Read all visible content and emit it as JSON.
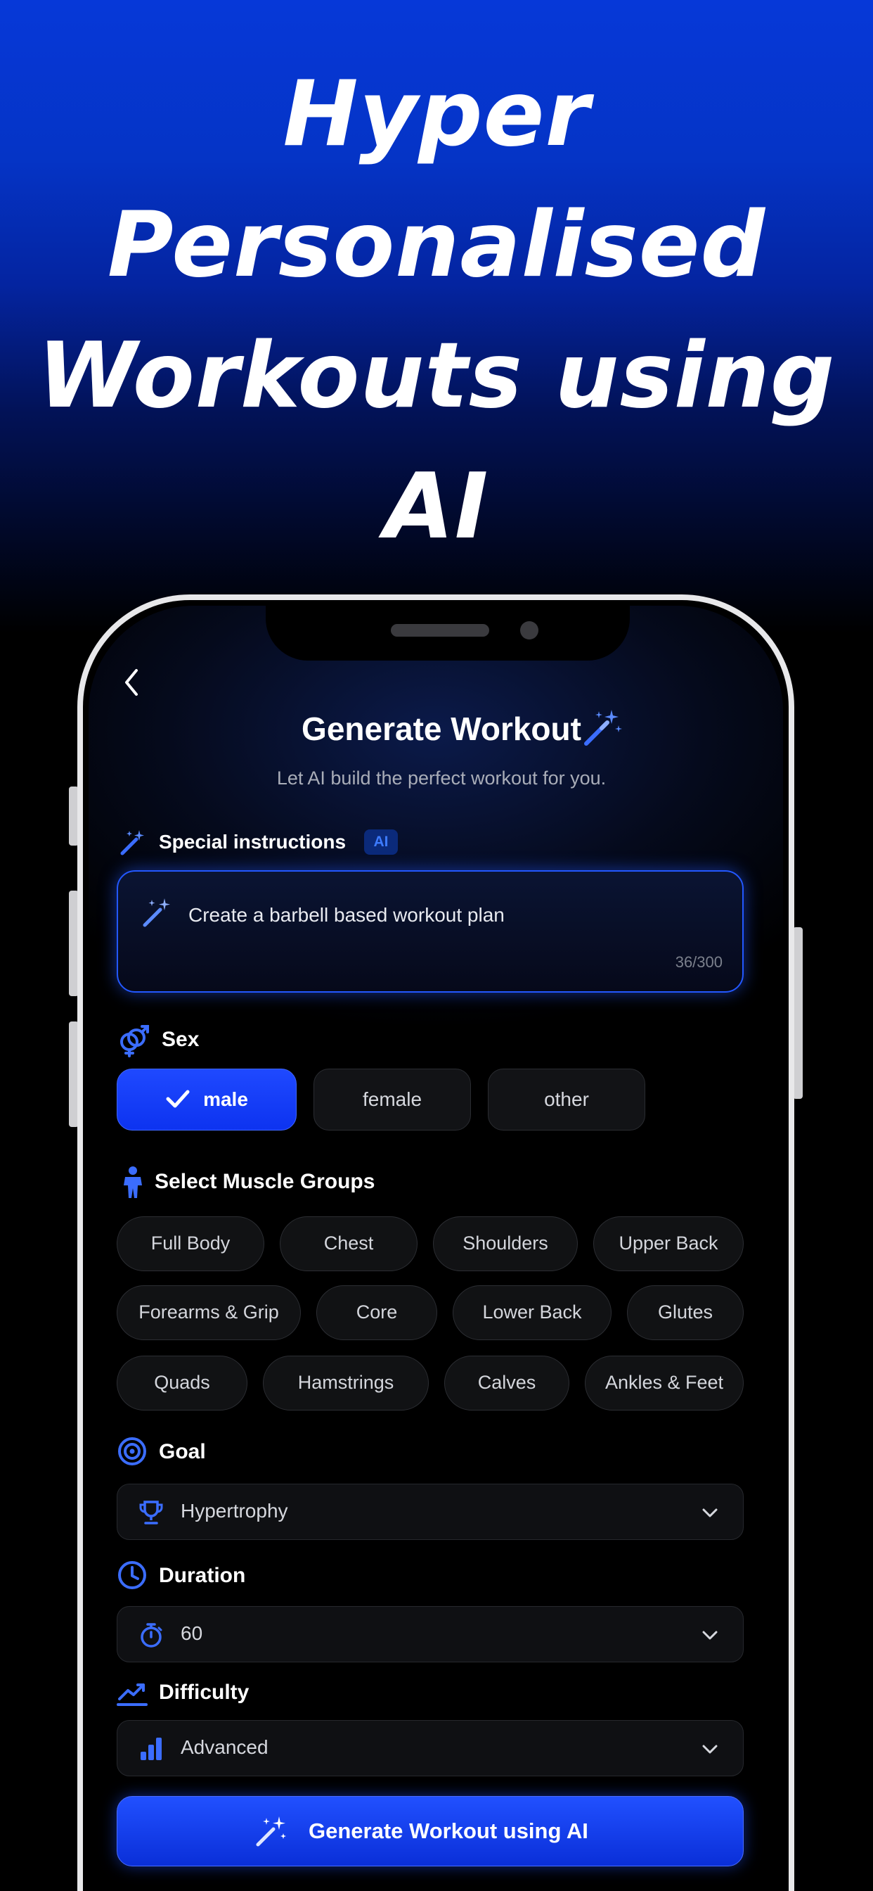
{
  "hero": {
    "title_lines": [
      "Hyper",
      "Personalised",
      "Workouts using",
      "AI"
    ]
  },
  "header": {
    "title": "Generate Workout",
    "subtitle": "Let AI build the perfect workout for you.",
    "back_icon": "chevron-left-icon",
    "title_icon": "magic-wand-icon"
  },
  "special_instructions": {
    "label": "Special instructions",
    "badge": "AI",
    "value": "Create a barbell based workout plan",
    "char_count": "36/300",
    "icon": "magic-wand-icon"
  },
  "sex": {
    "label": "Sex",
    "icon": "gender-icon",
    "options": [
      "male",
      "female",
      "other"
    ],
    "selected": "male"
  },
  "muscle_groups": {
    "label": "Select Muscle Groups",
    "icon": "person-icon",
    "items": [
      "Full Body",
      "Chest",
      "Shoulders",
      "Upper Back",
      "Forearms & Grip",
      "Core",
      "Lower Back",
      "Glutes",
      "Quads",
      "Hamstrings",
      "Calves",
      "Ankles & Feet"
    ]
  },
  "goal": {
    "label": "Goal",
    "icon": "target-icon",
    "value": "Hypertrophy",
    "value_icon": "trophy-icon"
  },
  "duration": {
    "label": "Duration",
    "icon": "clock-icon",
    "value": "60",
    "value_icon": "stopwatch-icon"
  },
  "difficulty": {
    "label": "Difficulty",
    "icon": "trend-icon",
    "value": "Advanced",
    "value_icon": "bar-chart-icon"
  },
  "generate_button": {
    "label": "Generate Workout using AI",
    "icon": "magic-wand-icon"
  },
  "colors": {
    "accent": "#1f49ff",
    "hero_blue": "#0638d8",
    "background": "#000000"
  }
}
